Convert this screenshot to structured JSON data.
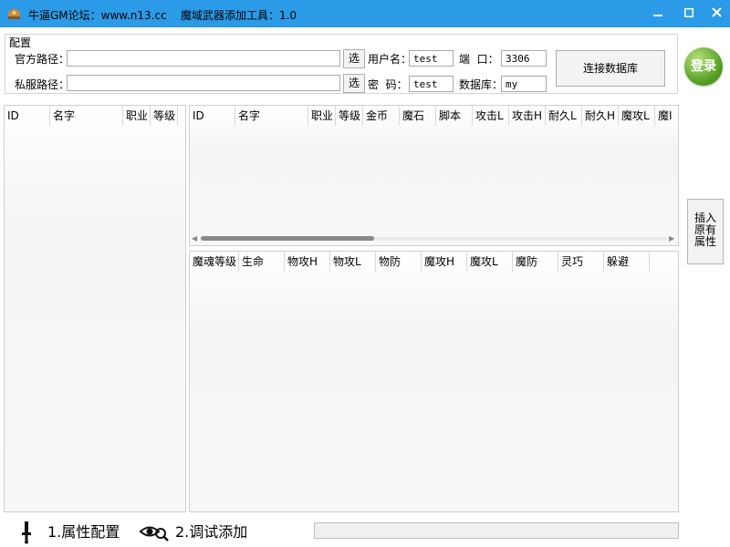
{
  "window": {
    "title": "牛逼GM论坛：www.n13.cc    魔域武器添加工具：1.0",
    "minimize_icon": "minimize-icon",
    "maximize_icon": "maximize-icon",
    "close_icon": "close-icon",
    "accent_color": "#2b9ae7"
  },
  "config": {
    "group_label": "配置",
    "official_path_label": "官方路径：",
    "official_path_value": "",
    "private_path_label": "私服路径：",
    "private_path_value": "",
    "browse_label": "选",
    "username_label": "用户名：",
    "username_value": "test",
    "password_label": "密  码：",
    "password_value": "test",
    "port_label": "端  口：",
    "port_value": "3306",
    "database_label": "数据库：",
    "database_value": "my",
    "connect_label": "连接数据库",
    "login_label": "登录"
  },
  "left_grid": {
    "columns": [
      "ID",
      "名字",
      "职业",
      "等级"
    ]
  },
  "top_grid": {
    "columns": [
      "ID",
      "名字",
      "职业",
      "等级",
      "金币",
      "魔石",
      "脚本",
      "攻击L",
      "攻击H",
      "耐久L",
      "耐久H",
      "魔攻L",
      "魔I"
    ]
  },
  "bottom_grid": {
    "columns": [
      "魔魂等级",
      "生命",
      "物攻H",
      "物攻L",
      "物防",
      "魔攻H",
      "魔攻L",
      "魔防",
      "灵巧",
      "躲避"
    ]
  },
  "insert_button": {
    "line1": "插入",
    "line2": "原有",
    "line3": "属性"
  },
  "bottom": {
    "nav1_label": "1.属性配置",
    "nav2_label": "2.调试添加",
    "progress": 0
  }
}
